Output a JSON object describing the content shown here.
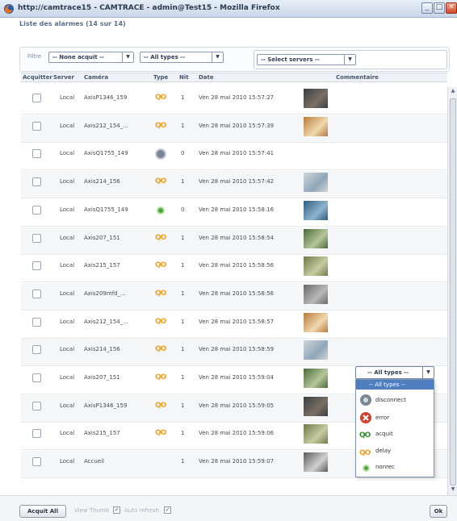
{
  "window": {
    "title": "http://camtrace15 - CAMTRACE - admin@Test15 - Mozilla Firefox",
    "min_label": "_",
    "max_label": "□",
    "close_label": "✕"
  },
  "page": {
    "subtitle": "Liste des alarmes (14 sur 14)"
  },
  "filters": {
    "label": "Filtre",
    "ack_select": "-- None acquit --",
    "type_select": "-- All types --",
    "server_select": "-- Select servers --"
  },
  "table": {
    "columns": [
      "Acquitter",
      "Server",
      "Caméra",
      "Type",
      "Nit",
      "Date",
      "",
      "Commentaire"
    ],
    "rows": [
      {
        "server": "Local",
        "camera": "AxisP1346_159",
        "type": "acquit",
        "nit": "1",
        "date": "Ven 28 mai 2010 15:57:27",
        "thumb": "dark"
      },
      {
        "server": "Local",
        "camera": "Axis212_154_...",
        "type": "acquit",
        "nit": "1",
        "date": "Ven 28 mai 2010 15:57:39",
        "thumb": "warm"
      },
      {
        "server": "Local",
        "camera": "AxisQ1755_149",
        "type": "disconnect",
        "nit": "0",
        "date": "Ven 28 mai 2010 15:57:41",
        "thumb": "none"
      },
      {
        "server": "Local",
        "camera": "Axis214_156",
        "type": "acquit",
        "nit": "1",
        "date": "Ven 28 mai 2010 15:57:42",
        "thumb": "pale"
      },
      {
        "server": "Local",
        "camera": "AxisQ1755_149",
        "type": "nonrec",
        "nit": "0",
        "date": "Ven 28 mai 2010 15:58:16",
        "thumb": "blue"
      },
      {
        "server": "Local",
        "camera": "Axis207_151",
        "type": "acquit",
        "nit": "1",
        "date": "Ven 28 mai 2010 15:58:54",
        "thumb": "green"
      },
      {
        "server": "Local",
        "camera": "Axis215_157",
        "type": "acquit",
        "nit": "1",
        "date": "Ven 28 mai 2010 15:58:56",
        "thumb": "olive"
      },
      {
        "server": "Local",
        "camera": "Axis209mfd_...",
        "type": "acquit",
        "nit": "1",
        "date": "Ven 28 mai 2010 15:58:56",
        "thumb": "gray"
      },
      {
        "server": "Local",
        "camera": "Axis212_154_...",
        "type": "acquit",
        "nit": "1",
        "date": "Ven 28 mai 2010 15:58:57",
        "thumb": "warm"
      },
      {
        "server": "Local",
        "camera": "Axis214_156",
        "type": "acquit",
        "nit": "1",
        "date": "Ven 28 mai 2010 15:58:59",
        "thumb": "pale"
      },
      {
        "server": "Local",
        "camera": "Axis207_151",
        "type": "acquit",
        "nit": "1",
        "date": "Ven 28 mai 2010 15:59:04",
        "thumb": "green"
      },
      {
        "server": "Local",
        "camera": "AxisP1346_159",
        "type": "acquit",
        "nit": "1",
        "date": "Ven 28 mai 2010 15:59:05",
        "thumb": "dark"
      },
      {
        "server": "Local",
        "camera": "Axis215_157",
        "type": "acquit",
        "nit": "1",
        "date": "Ven 28 mai 2010 15:59:06",
        "thumb": "olive"
      },
      {
        "server": "Local",
        "camera": "Accueil",
        "type": "",
        "nit": "1",
        "date": "Ven 28 mai 2010 15:59:07",
        "thumb": "gray2"
      }
    ]
  },
  "type_icons": {
    "acquit": "QO",
    "acquit_color": "#f0a020",
    "nonrec_color": "#4aa83a"
  },
  "dropdown": {
    "selected": "-- All types --",
    "options": [
      "-- All types --",
      "disconnect",
      "error",
      "acquit",
      "delay",
      "nonrec"
    ]
  },
  "footer": {
    "ack_all": "Acquit All",
    "view_thumb": "View Thumb",
    "auto_refresh": "Auto refresh",
    "corner_button": "Ok"
  }
}
